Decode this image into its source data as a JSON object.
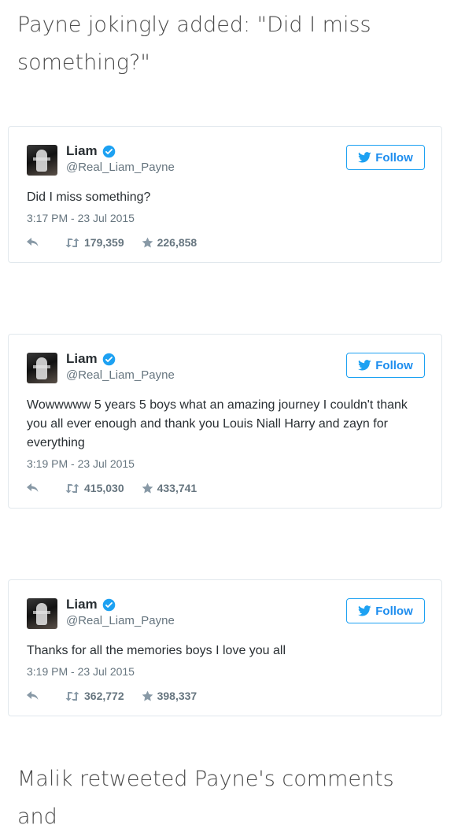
{
  "article": {
    "intro": "Payne jokingly added: \"Did I miss something?\"",
    "outro": "Malik retweeted Payne's comments and"
  },
  "colors": {
    "accent": "#1da1f2",
    "text": "#292f33",
    "muted": "#66757f",
    "border": "#e1e8ed"
  },
  "tweets": [
    {
      "name": "Liam",
      "handle": "@Real_Liam_Payne",
      "follow_label": "Follow",
      "text": "Did I miss something?",
      "time": "3:17 PM - 23 Jul 2015",
      "retweets": "179,359",
      "favorites": "226,858"
    },
    {
      "name": "Liam",
      "handle": "@Real_Liam_Payne",
      "follow_label": "Follow",
      "text": "Wowwwww 5 years 5 boys what an amazing journey I couldn't thank you all ever enough and thank you Louis Niall Harry and zayn for everything",
      "time": "3:19 PM - 23 Jul 2015",
      "retweets": "415,030",
      "favorites": "433,741"
    },
    {
      "name": "Liam",
      "handle": "@Real_Liam_Payne",
      "follow_label": "Follow",
      "text": "Thanks for all the memories boys I love you all",
      "time": "3:19 PM - 23 Jul 2015",
      "retweets": "362,772",
      "favorites": "398,337"
    }
  ],
  "icons": {
    "verified": "verified-badge-icon",
    "bird": "twitter-bird-icon",
    "reply": "reply-icon",
    "retweet": "retweet-icon",
    "favorite": "star-icon"
  }
}
